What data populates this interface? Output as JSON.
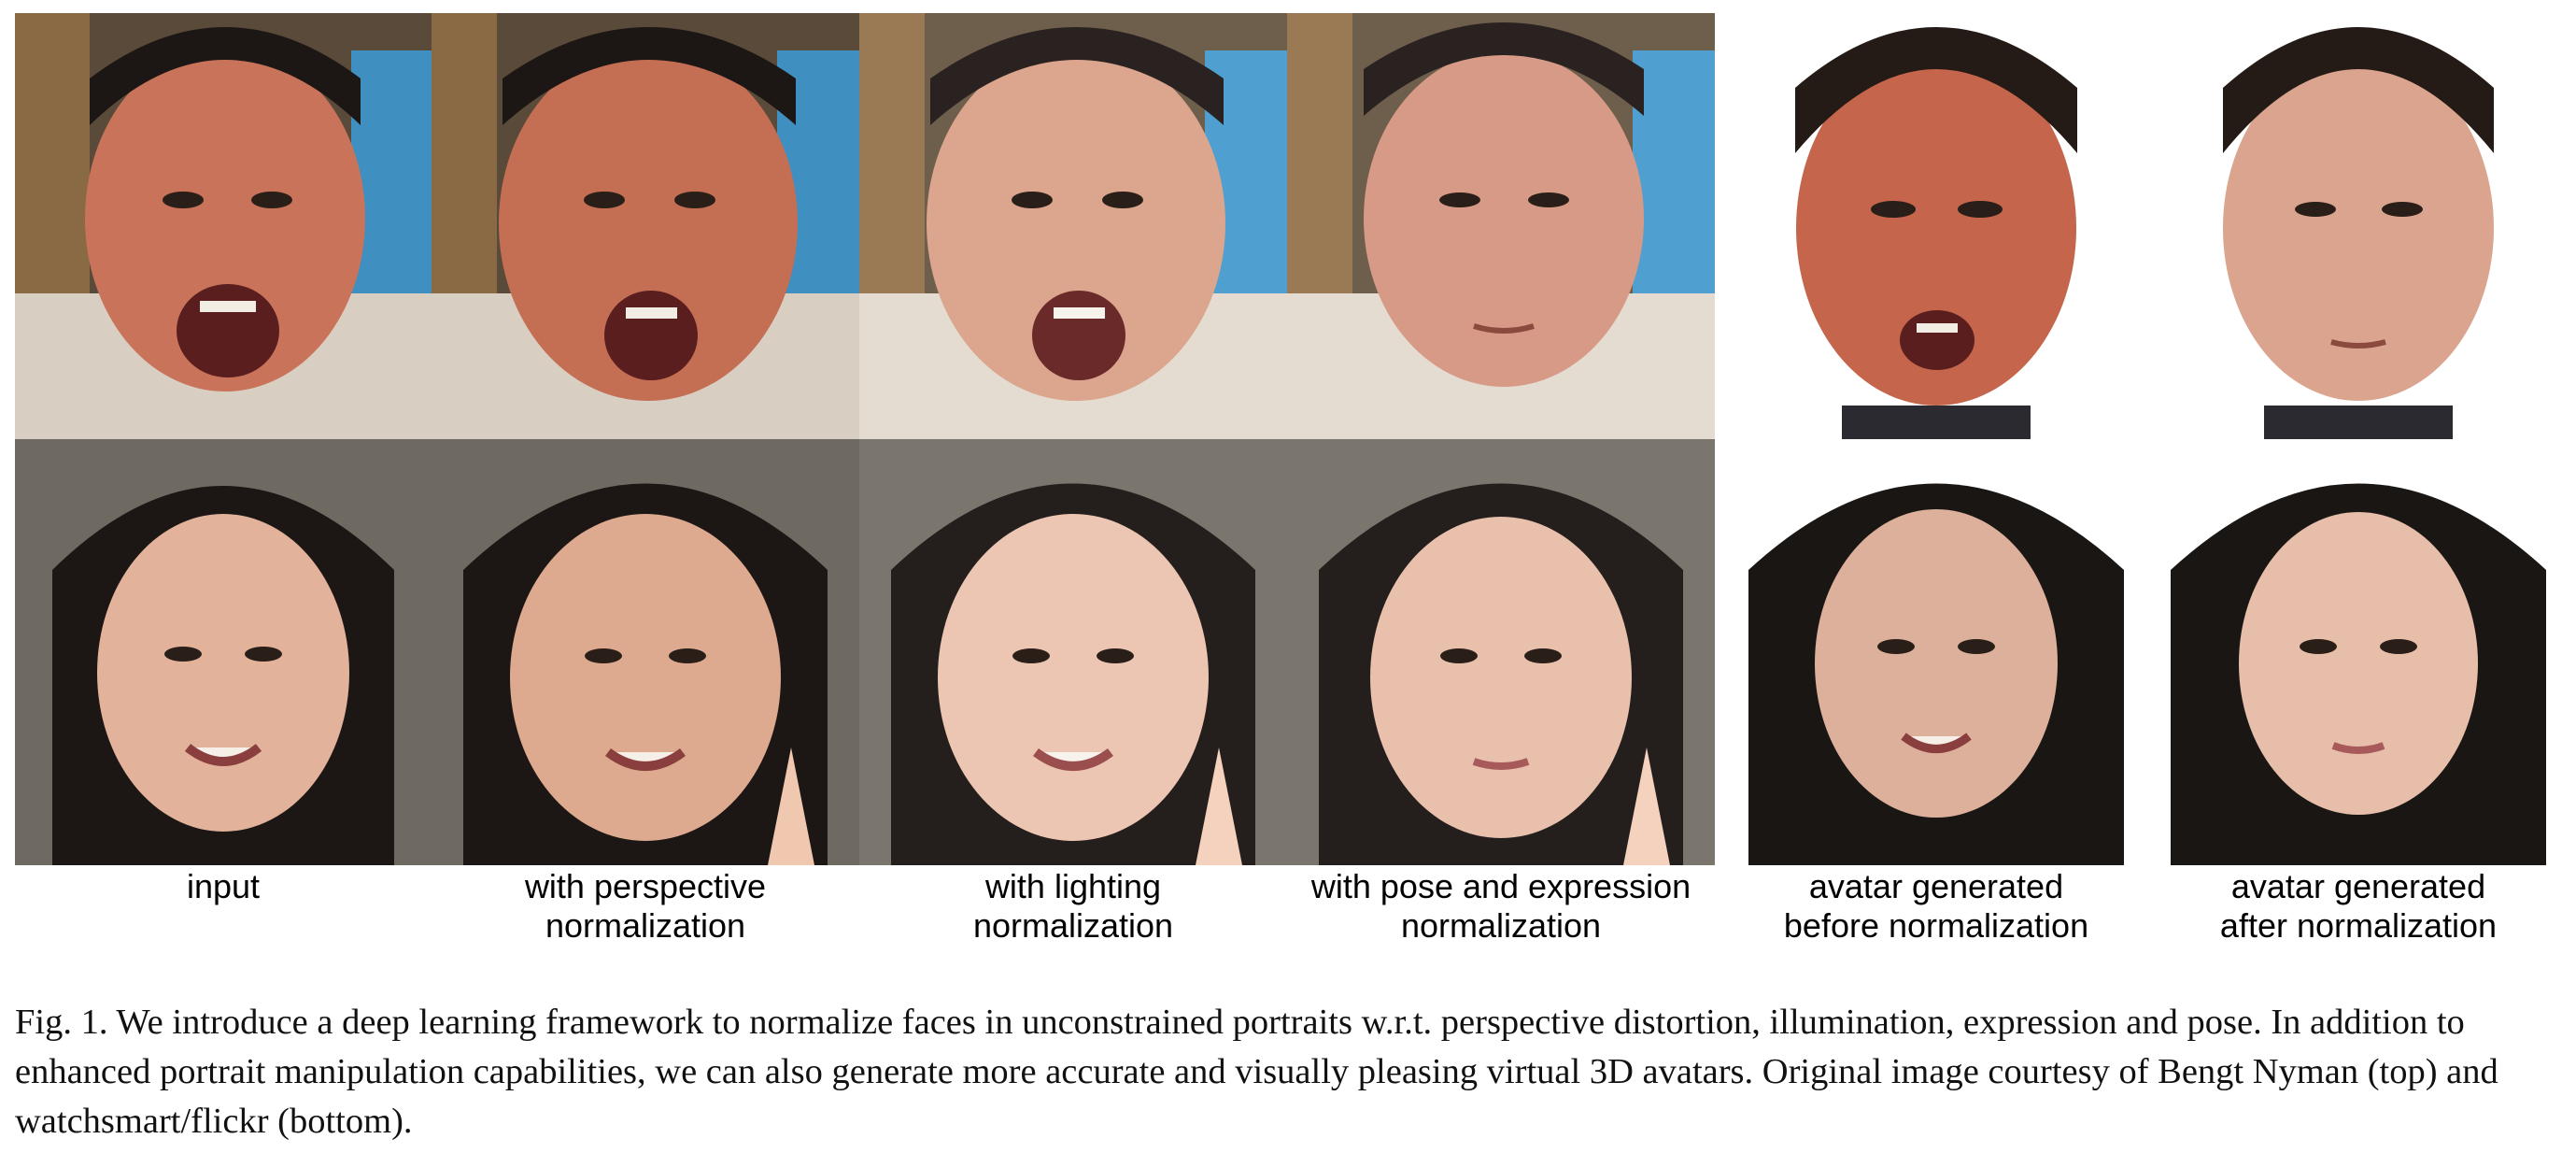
{
  "figure": {
    "columns": [
      {
        "label": "input"
      },
      {
        "label": "with perspective\nnormalization"
      },
      {
        "label": "with lighting\nnormalization"
      },
      {
        "label": "with pose and expression\nnormalization"
      },
      {
        "label": "avatar generated\nbefore normalization"
      },
      {
        "label": "avatar generated\nafter normalization"
      }
    ],
    "rows": [
      {
        "subject": "adult man, shouting expression"
      },
      {
        "subject": "girl, smiling with peace sign"
      }
    ]
  },
  "caption": {
    "text": "Fig. 1.  We introduce a deep learning framework to normalize faces in unconstrained portraits w.r.t. perspective distortion, illumination, expression and pose. In addition to enhanced portrait manipulation capabilities, we can also generate more accurate and visually pleasing virtual 3D avatars. Original image courtesy of Bengt Nyman (top) and watchsmart/flickr (bottom)."
  },
  "colors": {
    "man_skin_warm": "#c9735a",
    "man_skin_neutral": "#d79a86",
    "girl_skin": "#e2b29a",
    "hair_dark": "#1c1614",
    "shirt_blue": "#3f8fc0",
    "background_warm": "#6b5a48",
    "avatar_bg": "#ffffff"
  }
}
